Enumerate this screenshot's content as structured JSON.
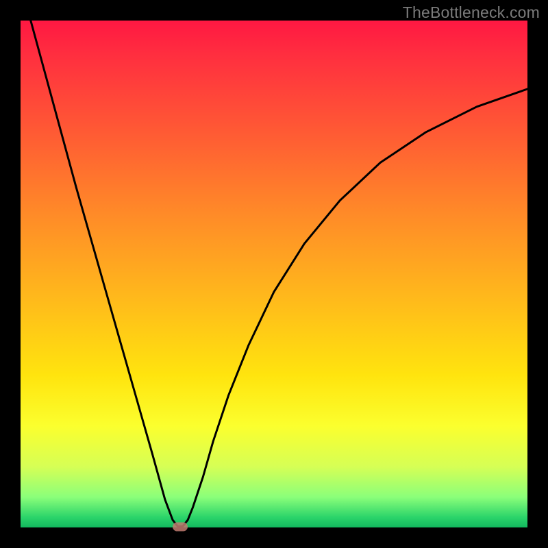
{
  "watermark": "TheBottleneck.com",
  "chart_data": {
    "type": "line",
    "title": "",
    "xlabel": "",
    "ylabel": "",
    "xlim": [
      0,
      100
    ],
    "ylim": [
      0,
      100
    ],
    "series": [
      {
        "name": "bottleneck-curve",
        "x": [
          2,
          5,
          8,
          11,
          14,
          17,
          20,
          23,
          26,
          28.5,
          30,
          31,
          32,
          33,
          34,
          36,
          38,
          41,
          45,
          50,
          56,
          63,
          71,
          80,
          90,
          100
        ],
        "y": [
          100,
          89,
          78,
          67,
          56.5,
          46,
          35.5,
          25,
          14.5,
          5.5,
          1.5,
          0.2,
          0.2,
          1.5,
          4,
          10,
          17,
          26,
          36,
          46.5,
          56,
          64.5,
          72,
          78,
          83,
          86.5
        ]
      }
    ],
    "marker": {
      "x": 31.5,
      "y": 0.2
    },
    "background_gradient": {
      "top": "#ff1842",
      "upper_mid": "#ff8a28",
      "mid": "#ffe40e",
      "lower_mid": "#d6ff55",
      "bottom": "#12b75e"
    }
  }
}
